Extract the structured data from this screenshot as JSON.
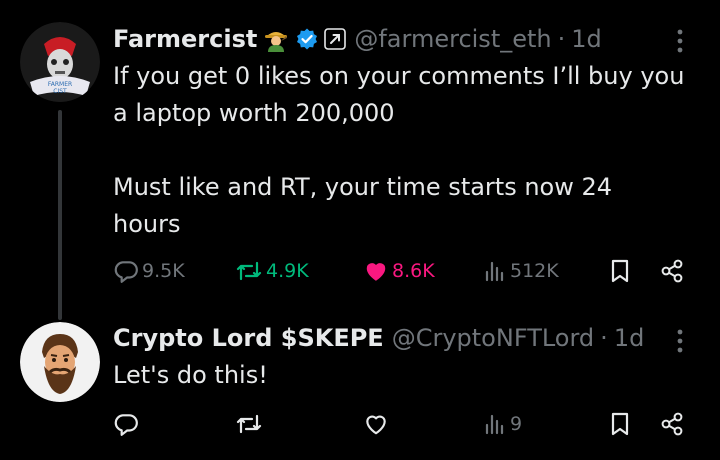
{
  "colors": {
    "background": "#000000",
    "text": "#e7e9ea",
    "muted": "#71767b",
    "verified": "#1d9bf0",
    "retweeted": "#00ba7c",
    "liked": "#f91880",
    "thread_line": "#333639"
  },
  "tweets": [
    {
      "display_name": "Farmercist",
      "name_emoji": "farmer-emoji",
      "verified": true,
      "affiliate_badge": "arrow-badge",
      "handle": "@farmercist_eth",
      "separator": "·",
      "time": "1d",
      "text": "If you get 0 likes on your comments I’ll buy you\na laptop worth 200,000\n\nMust like and RT, your time starts now 24\nhours",
      "avatar_text": "FARMER\nCIST",
      "actions": {
        "replies": "9.5K",
        "retweets": "4.9K",
        "likes": "8.6K",
        "views": "512K",
        "retweeted": true,
        "liked": true
      },
      "icons": [
        "reply-icon",
        "retweet-icon",
        "heart-icon",
        "views-icon",
        "bookmark-icon",
        "share-icon",
        "more-icon"
      ]
    },
    {
      "display_name": "Crypto Lord $SKEPE",
      "handle": "@CryptoNFTLord",
      "separator": "·",
      "time": "1d",
      "text": "Let's do this!",
      "actions": {
        "replies": "",
        "retweets": "",
        "likes": "",
        "views": "9",
        "retweeted": false,
        "liked": false
      },
      "icons": [
        "reply-icon",
        "retweet-icon",
        "heart-icon",
        "views-icon",
        "bookmark-icon",
        "share-icon",
        "more-icon"
      ]
    }
  ]
}
